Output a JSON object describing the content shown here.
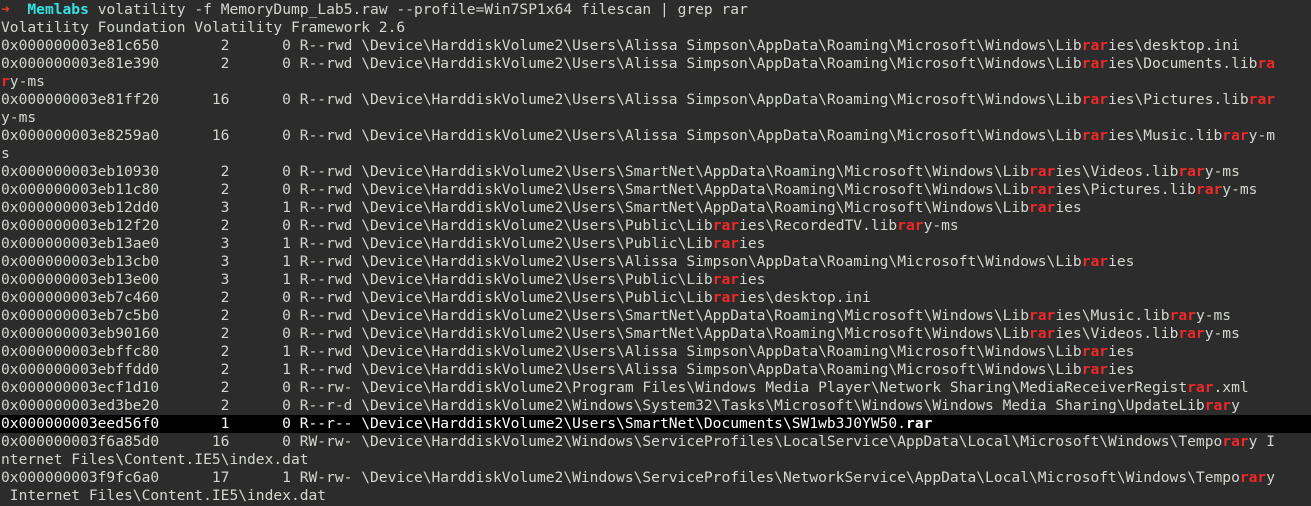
{
  "prompt": {
    "arrow": "➜",
    "dir": "Memlabs",
    "command": "volatility -f MemoryDump_Lab5.raw --profile=Win7SP1x64 filescan | grep rar"
  },
  "banner": "Volatility Foundation Volatility Framework 2.6",
  "highlight_term": "rar",
  "highlight_color": "#ef2929",
  "selected_row_index": 19,
  "lines": [
    "0x000000003e81c650       2      0 R--rwd \\Device\\HarddiskVolume2\\Users\\Alissa Simpson\\AppData\\Roaming\\Microsoft\\Windows\\Libraries\\desktop.ini",
    "0x000000003e81e390       2      0 R--rwd \\Device\\HarddiskVolume2\\Users\\Alissa Simpson\\AppData\\Roaming\\Microsoft\\Windows\\Libraries\\Documents.library-ms",
    "0x000000003e81ff20      16      0 R--rwd \\Device\\HarddiskVolume2\\Users\\Alissa Simpson\\AppData\\Roaming\\Microsoft\\Windows\\Libraries\\Pictures.library-ms",
    "0x000000003e8259a0      16      0 R--rwd \\Device\\HarddiskVolume2\\Users\\Alissa Simpson\\AppData\\Roaming\\Microsoft\\Windows\\Libraries\\Music.library-ms",
    "0x000000003eb10930       2      0 R--rwd \\Device\\HarddiskVolume2\\Users\\SmartNet\\AppData\\Roaming\\Microsoft\\Windows\\Libraries\\Videos.library-ms",
    "0x000000003eb11c80       2      0 R--rwd \\Device\\HarddiskVolume2\\Users\\SmartNet\\AppData\\Roaming\\Microsoft\\Windows\\Libraries\\Pictures.library-ms",
    "0x000000003eb12dd0       3      1 R--rwd \\Device\\HarddiskVolume2\\Users\\SmartNet\\AppData\\Roaming\\Microsoft\\Windows\\Libraries",
    "0x000000003eb12f20       2      0 R--rwd \\Device\\HarddiskVolume2\\Users\\Public\\Libraries\\RecordedTV.library-ms",
    "0x000000003eb13ae0       3      1 R--rwd \\Device\\HarddiskVolume2\\Users\\Public\\Libraries",
    "0x000000003eb13cb0       3      1 R--rwd \\Device\\HarddiskVolume2\\Users\\Alissa Simpson\\AppData\\Roaming\\Microsoft\\Windows\\Libraries",
    "0x000000003eb13e00       3      1 R--rwd \\Device\\HarddiskVolume2\\Users\\Public\\Libraries",
    "0x000000003eb7c460       2      0 R--rwd \\Device\\HarddiskVolume2\\Users\\Public\\Libraries\\desktop.ini",
    "0x000000003eb7c5b0       2      0 R--rwd \\Device\\HarddiskVolume2\\Users\\SmartNet\\AppData\\Roaming\\Microsoft\\Windows\\Libraries\\Music.library-ms",
    "0x000000003eb90160       2      0 R--rwd \\Device\\HarddiskVolume2\\Users\\SmartNet\\AppData\\Roaming\\Microsoft\\Windows\\Libraries\\Videos.library-ms",
    "0x000000003ebffc80       2      1 R--rwd \\Device\\HarddiskVolume2\\Users\\Alissa Simpson\\AppData\\Roaming\\Microsoft\\Windows\\Libraries",
    "0x000000003ebffdd0       2      1 R--rwd \\Device\\HarddiskVolume2\\Users\\Alissa Simpson\\AppData\\Roaming\\Microsoft\\Windows\\Libraries",
    "0x000000003ecf1d10       2      0 R--rw- \\Device\\HarddiskVolume2\\Program Files\\Windows Media Player\\Network Sharing\\MediaReceiverRegistrar.xml",
    "0x000000003ed3be20       2      0 R--r-d \\Device\\HarddiskVolume2\\Windows\\System32\\Tasks\\Microsoft\\Windows\\Windows Media Sharing\\UpdateLibrary",
    "0x000000003eed56f0       1      0 R--r-- \\Device\\HarddiskVolume2\\Users\\SmartNet\\Documents\\SW1wb3J0YW50.rar",
    "0x000000003f6a85d0      16      0 RW-rw- \\Device\\HarddiskVolume2\\Windows\\ServiceProfiles\\LocalService\\AppData\\Local\\Microsoft\\Windows\\Temporary Internet Files\\Content.IE5\\index.dat",
    "0x000000003f9fc6a0      17      1 RW-rw- \\Device\\HarddiskVolume2\\Windows\\ServiceProfiles\\NetworkService\\AppData\\Local\\Microsoft\\Windows\\Temporary Internet Files\\Content.IE5\\index.dat"
  ]
}
